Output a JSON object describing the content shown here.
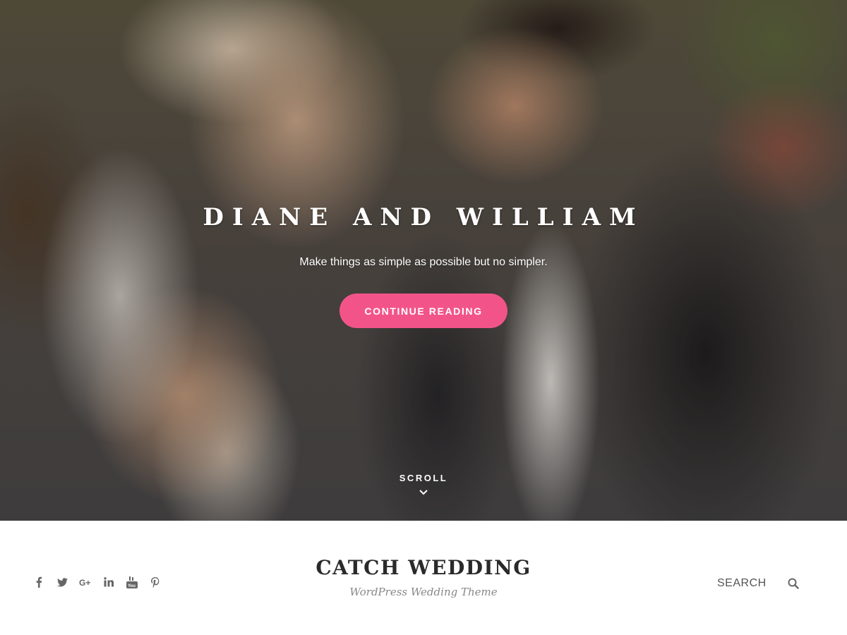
{
  "hero": {
    "title": "Diane and William",
    "subtitle": "Make things as simple as possible but no simpler.",
    "button_label": "Continue Reading",
    "button_color": "#f2548a",
    "scroll_label": "Scroll"
  },
  "header": {
    "site_title": "Catch Wedding",
    "site_description": "WordPress Wedding Theme",
    "search_label": "Search",
    "social_icons": [
      "facebook-icon",
      "twitter-icon",
      "google-plus-icon",
      "linkedin-icon",
      "youtube-icon",
      "pinterest-icon"
    ]
  }
}
